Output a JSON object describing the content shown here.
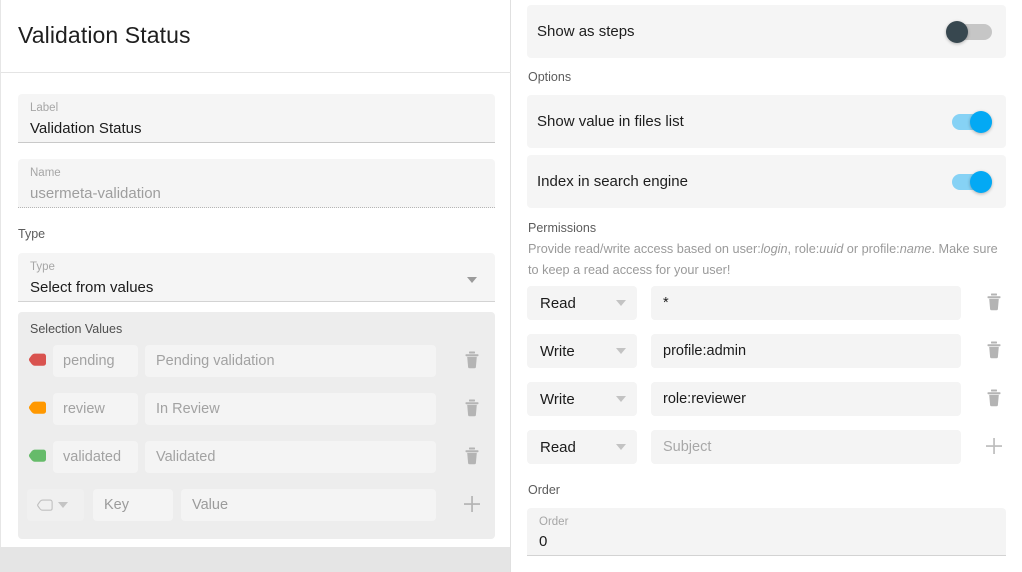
{
  "left": {
    "page_title": "Validation Status",
    "fields": [
      {
        "label": "Label",
        "value": "Validation Status",
        "disabled": false
      },
      {
        "label": "Name",
        "value": "usermeta-validation",
        "disabled": true
      }
    ],
    "type_section_label": "Type",
    "type_field": {
      "label": "Type",
      "value": "Select from values"
    },
    "selection_values": {
      "title": "Selection Values",
      "rows": [
        {
          "key": "pending",
          "value": "Pending validation",
          "color": "#d9534f",
          "delete_icon": "trash-icon"
        },
        {
          "key": "review",
          "value": "In Review",
          "color": "#ff9800",
          "delete_icon": "trash-icon"
        },
        {
          "key": "validated",
          "value": "Validated",
          "color": "#66bb6a",
          "delete_icon": "trash-icon"
        }
      ],
      "new_row": {
        "tag_icon": "tag-outline-icon",
        "key_placeholder": "Key",
        "value_placeholder": "Value",
        "add_icon": "plus-icon"
      }
    }
  },
  "right": {
    "show_as_steps": {
      "label": "Show as steps",
      "enabled": false
    },
    "options_label": "Options",
    "options": [
      {
        "label": "Show value in files list",
        "enabled": true
      },
      {
        "label": "Index in search engine",
        "enabled": true
      }
    ],
    "permissions": {
      "section_label": "Permissions",
      "description_parts": [
        {
          "text": "Provide read/write access based on user:",
          "italic": false
        },
        {
          "text": "login",
          "italic": true
        },
        {
          "text": ", role:",
          "italic": false
        },
        {
          "text": "uuid",
          "italic": true
        },
        {
          "text": " or profile:",
          "italic": false
        },
        {
          "text": "name",
          "italic": true
        },
        {
          "text": ". Make sure to keep a read access for your user!",
          "italic": false
        }
      ],
      "rows": [
        {
          "access": "Read",
          "subject": "*",
          "subject_is_placeholder": false,
          "action_icon": "trash-icon"
        },
        {
          "access": "Write",
          "subject": "profile:admin",
          "subject_is_placeholder": false,
          "action_icon": "trash-icon"
        },
        {
          "access": "Write",
          "subject": "role:reviewer",
          "subject_is_placeholder": false,
          "action_icon": "trash-icon"
        },
        {
          "access": "Read",
          "subject": "Subject",
          "subject_is_placeholder": true,
          "action_icon": "plus-icon"
        }
      ]
    },
    "order": {
      "section_label": "Order",
      "field_label": "Order",
      "value": "0"
    }
  },
  "colors": {
    "accent_blue": "#03a9f4",
    "toggle_off_knob": "#37474f",
    "field_bg": "#f5f5f5",
    "panel_bg": "#ffffff"
  }
}
